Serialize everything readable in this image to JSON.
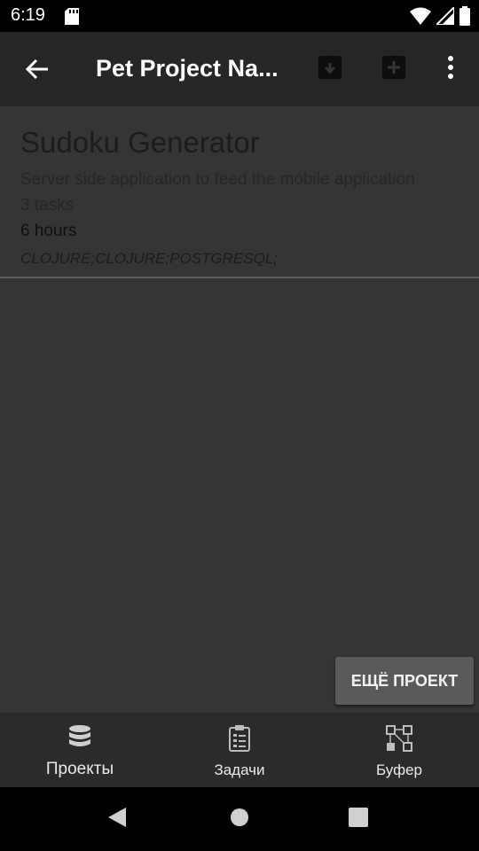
{
  "status_bar": {
    "time": "6:19",
    "icons": [
      "sd-card-icon",
      "wifi-icon",
      "signal-icon",
      "battery-icon"
    ]
  },
  "app_bar": {
    "title": "Pet Project Na...",
    "actions": [
      "arrow-back-icon",
      "archive-icon",
      "add-box-icon",
      "more-vert-icon"
    ]
  },
  "project": {
    "name": "Sudoku Generator",
    "description": "Server side application to feed the mobile application",
    "tasks": "3 tasks",
    "hours": "6 hours",
    "tags": "CLOJURE;CLOJURE;POSTGRESQL;"
  },
  "more_projects_button": "ЕЩЁ ПРОЕКТ",
  "bottom_nav": {
    "items": [
      {
        "label": "Проекты",
        "icon": "database-icon"
      },
      {
        "label": "Задачи",
        "icon": "clipboard-list-icon"
      },
      {
        "label": "Буфер",
        "icon": "buffer-nodes-icon"
      }
    ],
    "selected": "Проекты"
  },
  "colors": {
    "app_bar": "#262626",
    "content_background": "#353535",
    "bottom_nav": "#2b2b2b",
    "button": "#5a5a5a"
  }
}
